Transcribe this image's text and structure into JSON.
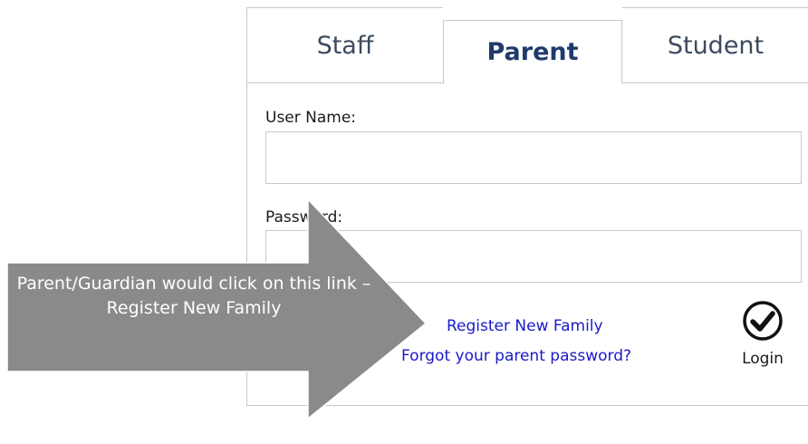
{
  "tabs": {
    "staff": "Staff",
    "parent": "Parent",
    "student": "Student"
  },
  "form": {
    "username_label": "User Name:",
    "username_value": "",
    "password_label": "Password:",
    "password_value": ""
  },
  "links": {
    "register": "Register New Family",
    "forgot": "Forgot your parent password?"
  },
  "login": {
    "label": "Login",
    "icon": "check-circle-icon"
  },
  "callout": {
    "text": "Parent/Guardian would click on this link – Register New Family",
    "color": "#8a8a8a"
  }
}
